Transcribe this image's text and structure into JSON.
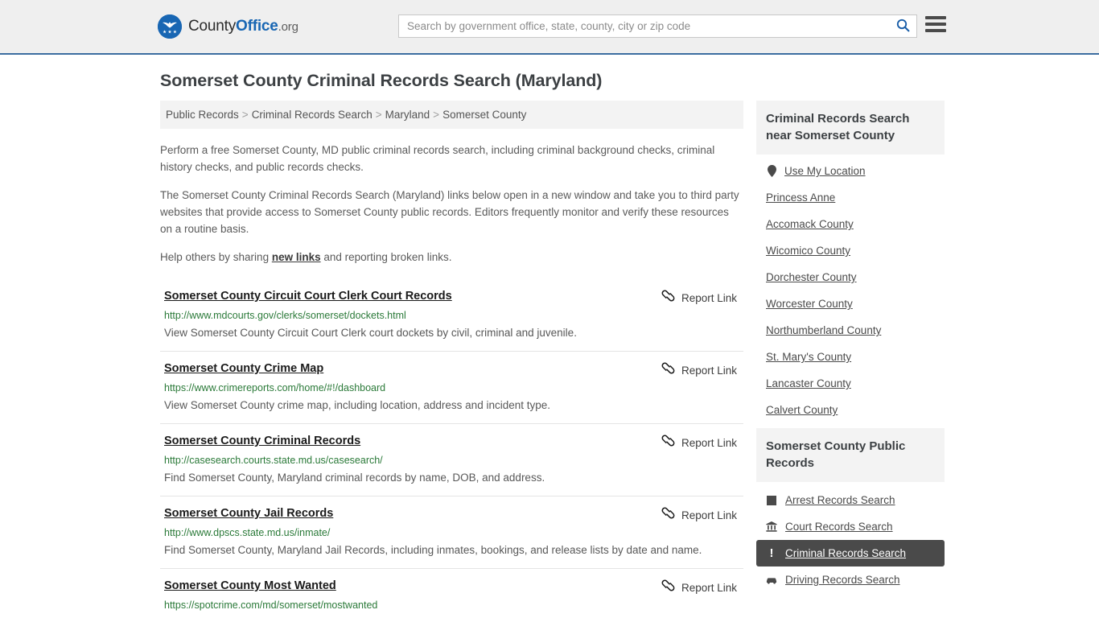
{
  "header": {
    "brand": {
      "part1": "County",
      "part2": "Office",
      "part3": ".org",
      "logo_icon": "eagle-shield-logo"
    },
    "search": {
      "placeholder": "Search by government office, state, county, city or zip code",
      "value": "",
      "search_icon": "search-icon"
    },
    "menu_icon": "hamburger-menu-icon",
    "accent_color": "#1866b3",
    "border_color": "#3c6da0"
  },
  "page": {
    "title": "Somerset County Criminal Records Search (Maryland)"
  },
  "breadcrumb": {
    "separator": ">",
    "items": [
      {
        "label": "Public Records"
      },
      {
        "label": "Criminal Records Search"
      },
      {
        "label": "Maryland"
      },
      {
        "label": "Somerset County"
      }
    ]
  },
  "intro": {
    "p1": "Perform a free Somerset County, MD public criminal records search, including criminal background checks, criminal history checks, and public records checks.",
    "p2": "The Somerset County Criminal Records Search (Maryland) links below open in a new window and take you to third party websites that provide access to Somerset County public records. Editors frequently monitor and verify these resources on a routine basis.",
    "p3_before": "Help others by sharing ",
    "p3_link": "new links",
    "p3_after": " and reporting broken links."
  },
  "results": {
    "report_label": "Report Link",
    "report_icon": "broken-link-icon",
    "url_color": "#2b7a39",
    "items": [
      {
        "title": "Somerset County Circuit Court Clerk Court Records",
        "url": "http://www.mdcourts.gov/clerks/somerset/dockets.html",
        "description": "View Somerset County Circuit Court Clerk court dockets by civil, criminal and juvenile."
      },
      {
        "title": "Somerset County Crime Map",
        "url": "https://www.crimereports.com/home/#!/dashboard",
        "description": "View Somerset County crime map, including location, address and incident type."
      },
      {
        "title": "Somerset County Criminal Records",
        "url": "http://casesearch.courts.state.md.us/casesearch/",
        "description": "Find Somerset County, Maryland criminal records by name, DOB, and address."
      },
      {
        "title": "Somerset County Jail Records",
        "url": "http://www.dpscs.state.md.us/inmate/",
        "description": "Find Somerset County, Maryland Jail Records, including inmates, bookings, and release lists by date and name."
      },
      {
        "title": "Somerset County Most Wanted",
        "url": "https://spotcrime.com/md/somerset/mostwanted",
        "description": ""
      }
    ]
  },
  "sidebar": {
    "nearby": {
      "heading": "Criminal Records Search near Somerset County",
      "use_my_location": {
        "label": "Use My Location",
        "icon": "map-pin-icon"
      },
      "items": [
        {
          "label": "Princess Anne"
        },
        {
          "label": "Accomack County"
        },
        {
          "label": "Wicomico County"
        },
        {
          "label": "Dorchester County"
        },
        {
          "label": "Worcester County"
        },
        {
          "label": "Northumberland County"
        },
        {
          "label": "St. Mary's County"
        },
        {
          "label": "Lancaster County"
        },
        {
          "label": "Calvert County"
        }
      ]
    },
    "public_records": {
      "heading": "Somerset County Public Records",
      "active_bg": "#4a4a4a",
      "items": [
        {
          "label": "Arrest Records Search",
          "icon": "fingerprint-square-icon",
          "active": false
        },
        {
          "label": "Court Records Search",
          "icon": "courthouse-icon",
          "active": false
        },
        {
          "label": "Criminal Records Search",
          "icon": "exclamation-icon",
          "active": true
        },
        {
          "label": "Driving Records Search",
          "icon": "car-icon",
          "active": false
        }
      ]
    }
  }
}
